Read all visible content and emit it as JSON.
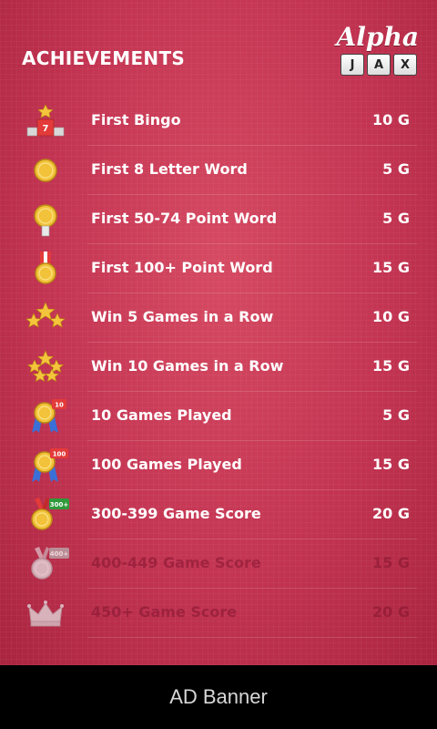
{
  "header": {
    "title": "ACHIEVEMENTS",
    "logo_script": "Alpha",
    "logo_tiles": [
      "J",
      "A",
      "X"
    ]
  },
  "achievements": [
    {
      "name": "First Bingo",
      "points": "10 G",
      "icon": "podium-star-icon",
      "badge": "7",
      "locked": false
    },
    {
      "name": "First 8 Letter Word",
      "points": "5 G",
      "icon": "gold-coin-icon",
      "locked": false
    },
    {
      "name": "First 50-74 Point Word",
      "points": "5 G",
      "icon": "gold-medal-icon",
      "locked": false
    },
    {
      "name": "First 100+ Point Word",
      "points": "15 G",
      "icon": "gold-medal-ribbon-icon",
      "locked": false
    },
    {
      "name": "Win 5 Games in a Row",
      "points": "10 G",
      "icon": "three-stars-icon",
      "locked": false
    },
    {
      "name": "Win 10 Games in a Row",
      "points": "15 G",
      "icon": "five-stars-icon",
      "locked": false
    },
    {
      "name": "10 Games Played",
      "points": "5 G",
      "icon": "ribbon-medal-icon",
      "badge": "10",
      "locked": false
    },
    {
      "name": "100 Games Played",
      "points": "15 G",
      "icon": "ribbon-medal-icon",
      "badge": "100",
      "locked": false
    },
    {
      "name": "300-399 Game Score",
      "points": "20 G",
      "icon": "gold-medal-tag-icon",
      "badge": "300+",
      "locked": false
    },
    {
      "name": "400-449 Game Score",
      "points": "15 G",
      "icon": "silver-medal-tag-icon",
      "badge": "400+",
      "locked": true
    },
    {
      "name": "450+ Game Score",
      "points": "20 G",
      "icon": "crown-icon",
      "locked": true
    }
  ],
  "ad": {
    "label": "AD Banner"
  },
  "colors": {
    "background": "#c33452",
    "text": "#ffffff",
    "locked_text": "#8c1a34",
    "ad_bar": "#000000"
  }
}
